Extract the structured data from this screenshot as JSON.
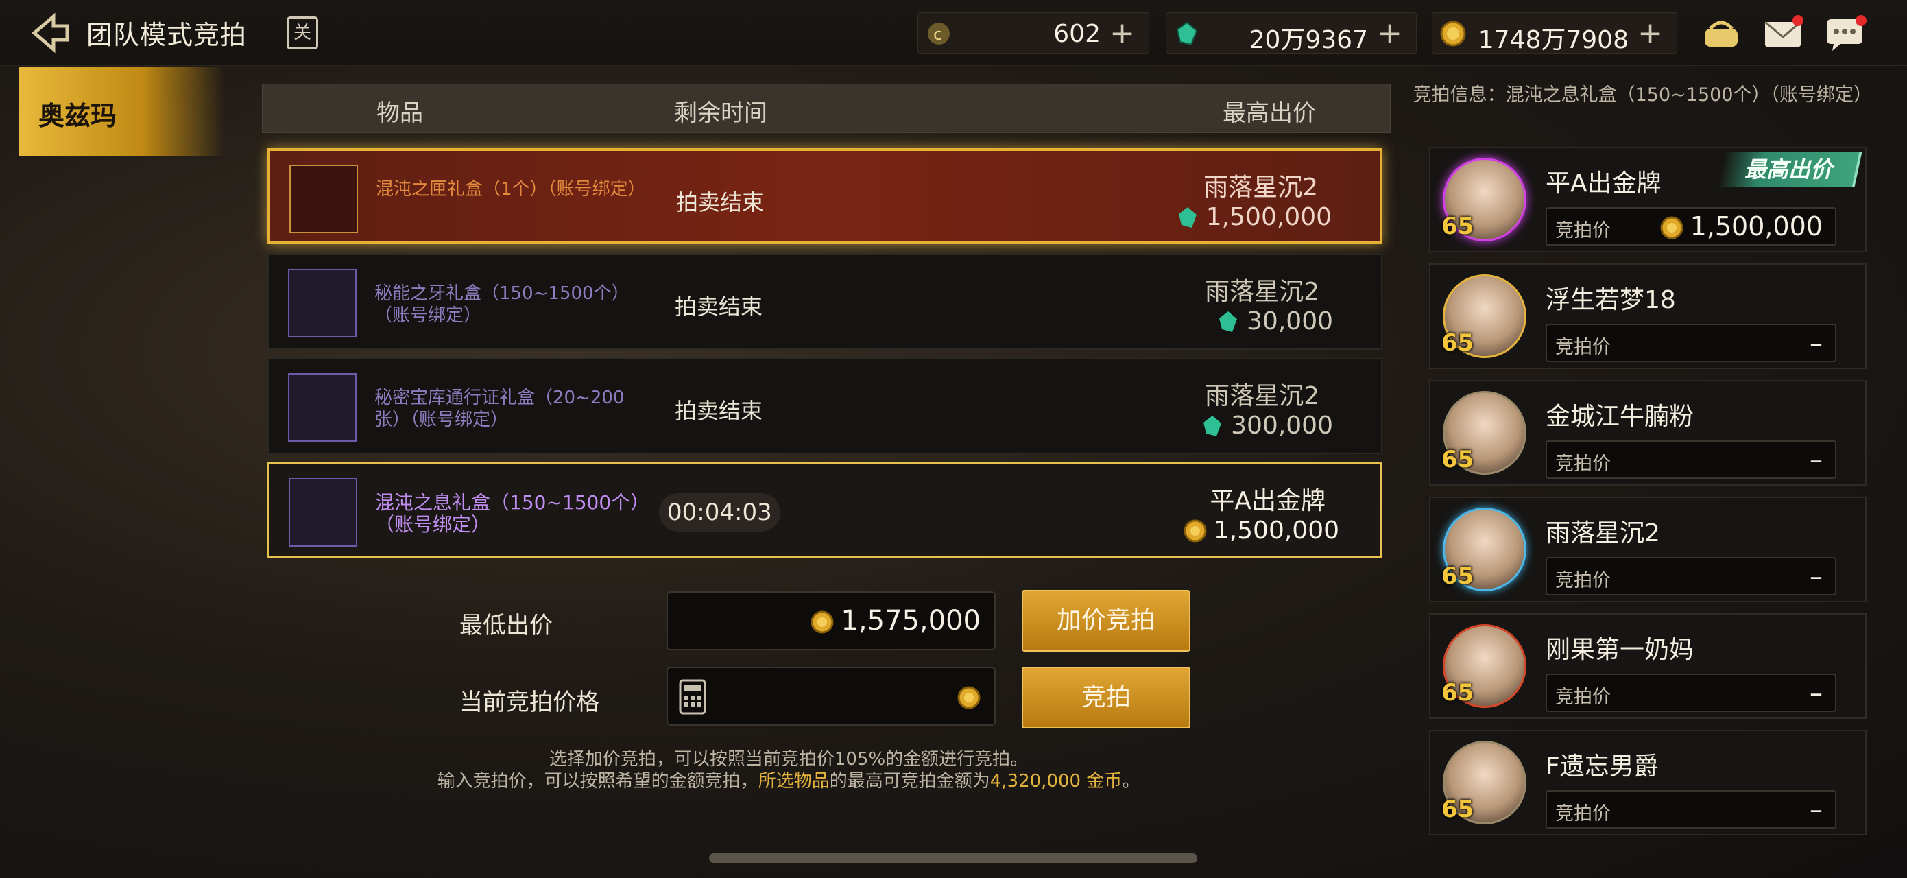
{
  "header": {
    "title": "团队模式竞拍",
    "calendar_label": "关",
    "currencies": [
      {
        "icon": "coin-c-icon",
        "value": "602"
      },
      {
        "icon": "green-gem-icon",
        "value": "20万9367"
      },
      {
        "icon": "gold-coin-icon",
        "value": "1748万7908"
      }
    ],
    "plus_label": "+"
  },
  "server_tab": "奥兹玛",
  "table": {
    "headers": [
      "物品",
      "剩余时间",
      "最高出价"
    ],
    "rows": [
      {
        "item": "混沌之匣礼盒（1个）（账号绑定）",
        "status": "拍卖结束",
        "bidder": "雨落星沉2",
        "amount": "1,500,000",
        "currency_icon": "green-gem-icon"
      },
      {
        "item": "秘能之牙礼盒（150~1500个）（账号绑定）",
        "status": "拍卖结束",
        "bidder": "雨落星沉2",
        "amount": "30,000",
        "currency_icon": "green-gem-icon"
      },
      {
        "item": "秘密宝库通行证礼盒（20~200张）（账号绑定）",
        "status": "拍卖结束",
        "bidder": "雨落星沉2",
        "amount": "300,000",
        "currency_icon": "green-gem-icon"
      },
      {
        "item": "混沌之息礼盒（150~1500个）（账号绑定）",
        "status": "00:04:03",
        "bidder": "平A出金牌",
        "amount": "1,500,000",
        "currency_icon": "gold-coin-icon"
      }
    ]
  },
  "bid_form": {
    "min_bid_label": "最低出价",
    "min_bid_value": "1,575,000",
    "raise_button": "加价竞拍",
    "current_price_label": "当前竞拍价格",
    "current_price_value": "",
    "bid_button": "竞拍",
    "hint_line1": "选择加价竞拍，可以按照当前竞拍价105%的金额进行竞拍。",
    "hint_line2_a": "输入竞拍价，可以按照希望的金额竞拍，",
    "hint_line2_b": "所选物品",
    "hint_line2_c": "的最高可竞拍金额为",
    "hint_line2_d": "4,320,000 金币",
    "hint_line2_e": "。"
  },
  "auction_info": "竞拍信息：混沌之息礼盒（150~1500个）（账号绑定）",
  "bidders": [
    {
      "name": "平A出金牌",
      "level": "65",
      "price_label": "竞拍价",
      "price": "1,500,000",
      "badge": "最高出价"
    },
    {
      "name": "浮生若梦18",
      "level": "65",
      "price_label": "竞拍价",
      "price": "–"
    },
    {
      "name": "金城江牛腩粉",
      "level": "65",
      "price_label": "竞拍价",
      "price": "–"
    },
    {
      "name": "雨落星沉2",
      "level": "65",
      "price_label": "竞拍价",
      "price": "–"
    },
    {
      "name": "刚果第一奶妈",
      "level": "65",
      "price_label": "竞拍价",
      "price": "–"
    },
    {
      "name": "F遗忘男爵",
      "level": "65",
      "price_label": "竞拍价",
      "price": "–"
    }
  ],
  "colors": {
    "accent_gold": "#e3b33d",
    "sold_red": "#7a2413",
    "item_purple": "#8f7cc0"
  }
}
